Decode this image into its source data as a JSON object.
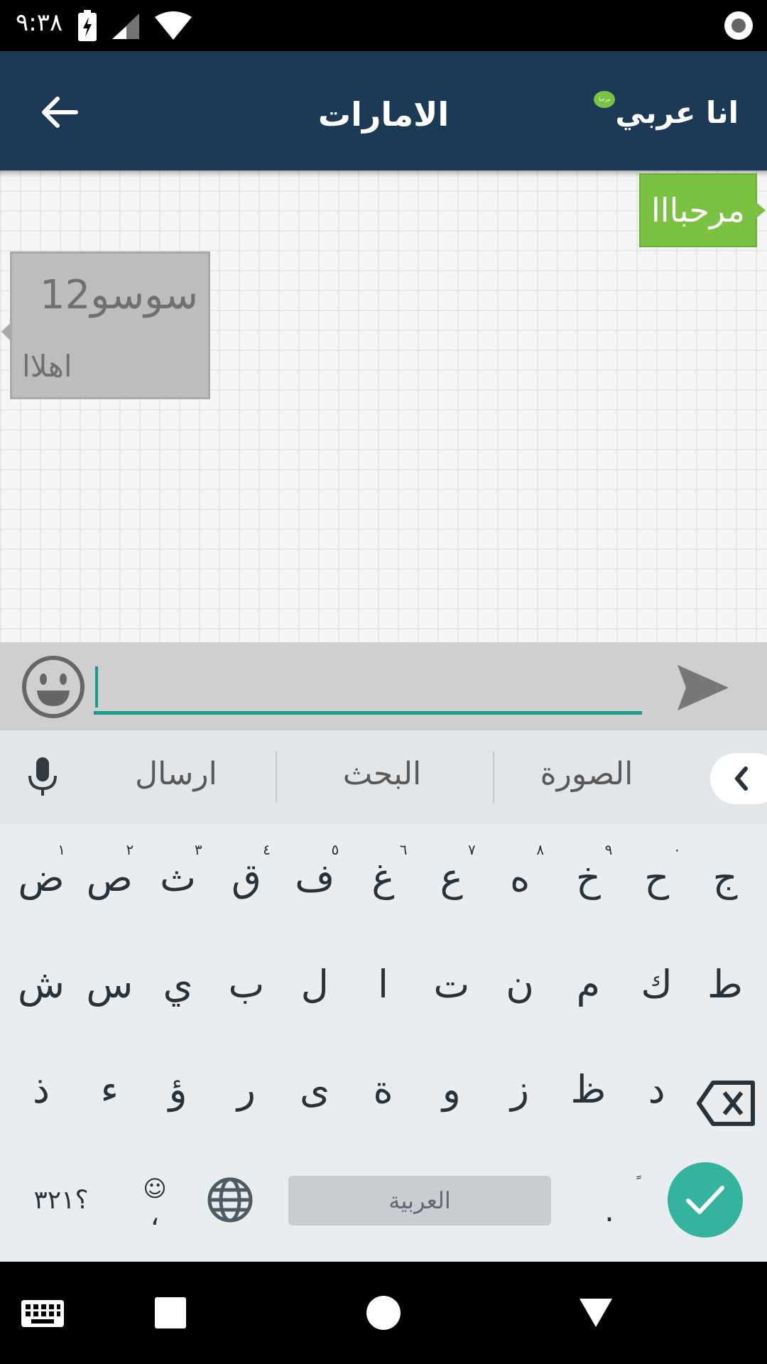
{
  "status_bar": {
    "time": "٩:٣٨"
  },
  "app_bar": {
    "title": "الامارات",
    "brand": "انا عربي",
    "brand_badge": "مرحبا"
  },
  "messages": {
    "outgoing": {
      "text": "مرحبااا"
    },
    "incoming": {
      "sender": "سوسو12",
      "text": "اهلاا"
    }
  },
  "input": {
    "value": "",
    "placeholder": ""
  },
  "keyboard": {
    "suggestions": [
      "ارسال",
      "البحث",
      "الصورة"
    ],
    "row1": [
      {
        "k": "ض",
        "h": "١"
      },
      {
        "k": "ص",
        "h": "٢"
      },
      {
        "k": "ث",
        "h": "٣"
      },
      {
        "k": "ق",
        "h": "٤"
      },
      {
        "k": "ف",
        "h": "٥"
      },
      {
        "k": "غ",
        "h": "٦"
      },
      {
        "k": "ع",
        "h": "٧"
      },
      {
        "k": "ه",
        "h": "٨"
      },
      {
        "k": "خ",
        "h": "٩"
      },
      {
        "k": "ح",
        "h": "٠"
      },
      {
        "k": "ج",
        "h": ""
      }
    ],
    "row2": [
      "ش",
      "س",
      "ي",
      "ب",
      "ل",
      "ا",
      "ت",
      "ن",
      "م",
      "ك",
      "ط"
    ],
    "row3": [
      "ذ",
      "ء",
      "ؤ",
      "ر",
      "ى",
      "ة",
      "و",
      "ز",
      "ظ",
      "د"
    ],
    "symbols_key": "؟٣٢١",
    "comma_key": "،",
    "period_key": ".",
    "space_label": "العربية"
  },
  "colors": {
    "app_bar": "#1c3a55",
    "outgoing_bubble": "#7cc242",
    "accent": "#1a9b8c",
    "enter": "#34b39e"
  },
  "icons": [
    "back-arrow-icon",
    "emoji-icon",
    "send-icon",
    "mic-icon",
    "chevron-left-icon",
    "backspace-icon",
    "globe-icon",
    "check-icon"
  ]
}
